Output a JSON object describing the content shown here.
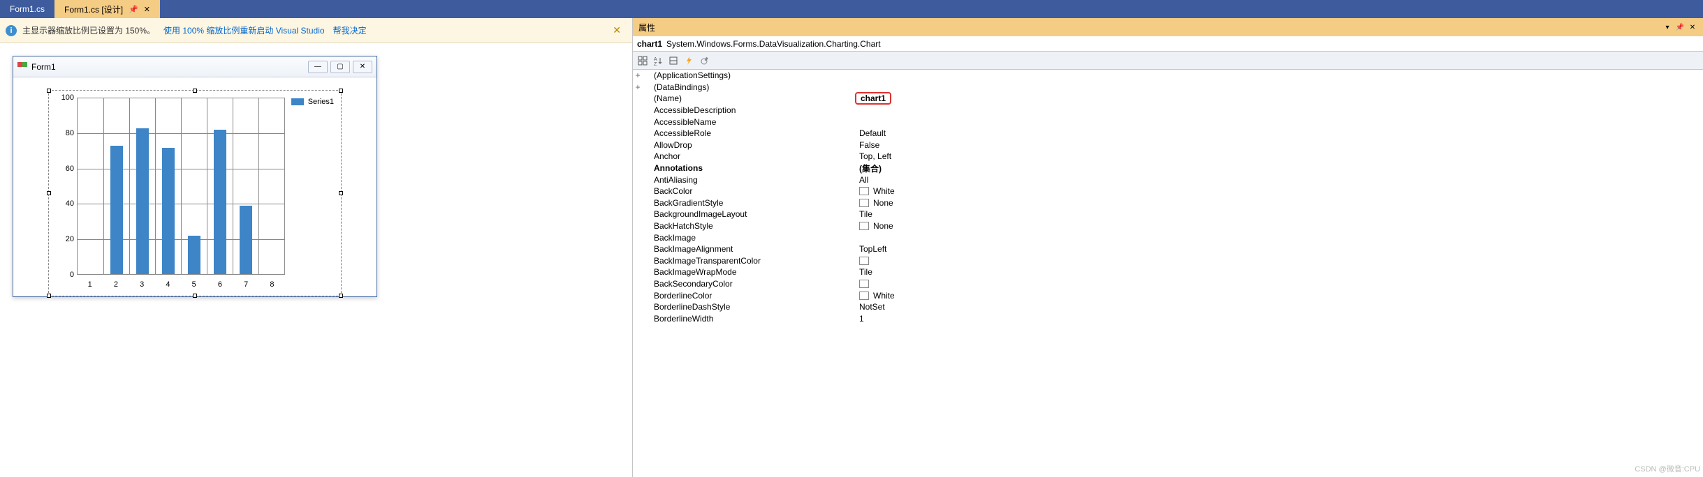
{
  "tabs": {
    "inactive": "Form1.cs",
    "active": "Form1.cs [设计]"
  },
  "infoBar": {
    "msg": "主显示器缩放比例已设置为 150%。",
    "link1": "使用 100% 缩放比例重新启动 Visual Studio",
    "link2": "帮我决定"
  },
  "form": {
    "title": "Form1"
  },
  "legend": "Series1",
  "chart_data": {
    "type": "bar",
    "categories": [
      "1",
      "2",
      "3",
      "4",
      "5",
      "6",
      "7",
      "8"
    ],
    "values": [
      null,
      73,
      83,
      72,
      22,
      82,
      39,
      null
    ],
    "title": "",
    "xlabel": "",
    "ylabel": "",
    "y_ticks": [
      0,
      20,
      40,
      60,
      80,
      100
    ],
    "ylim": [
      0,
      100
    ]
  },
  "propPanel": {
    "title": "属性",
    "objName": "chart1",
    "objType": "System.Windows.Forms.DataVisualization.Charting.Chart",
    "rows": [
      {
        "exp": "+",
        "name": "(ApplicationSettings)",
        "val": ""
      },
      {
        "exp": "+",
        "name": "(DataBindings)",
        "val": ""
      },
      {
        "exp": "",
        "name": "(Name)",
        "val": "chart1",
        "hl": true
      },
      {
        "exp": "",
        "name": "AccessibleDescription",
        "val": ""
      },
      {
        "exp": "",
        "name": "AccessibleName",
        "val": ""
      },
      {
        "exp": "",
        "name": "AccessibleRole",
        "val": "Default"
      },
      {
        "exp": "",
        "name": "AllowDrop",
        "val": "False"
      },
      {
        "exp": "",
        "name": "Anchor",
        "val": "Top, Left"
      },
      {
        "exp": "",
        "name": "Annotations",
        "val": "(集合)",
        "bold": true
      },
      {
        "exp": "",
        "name": "AntiAliasing",
        "val": "All"
      },
      {
        "exp": "",
        "name": "BackColor",
        "val": "White",
        "sw": "#ffffff"
      },
      {
        "exp": "",
        "name": "BackGradientStyle",
        "val": "None",
        "sw": "#ffffff"
      },
      {
        "exp": "",
        "name": "BackgroundImageLayout",
        "val": "Tile"
      },
      {
        "exp": "",
        "name": "BackHatchStyle",
        "val": "None",
        "sw": "#ffffff"
      },
      {
        "exp": "",
        "name": "BackImage",
        "val": ""
      },
      {
        "exp": "",
        "name": "BackImageAlignment",
        "val": "TopLeft"
      },
      {
        "exp": "",
        "name": "BackImageTransparentColor",
        "val": "",
        "sw": "#ffffff"
      },
      {
        "exp": "",
        "name": "BackImageWrapMode",
        "val": "Tile"
      },
      {
        "exp": "",
        "name": "BackSecondaryColor",
        "val": "",
        "sw": "#ffffff"
      },
      {
        "exp": "",
        "name": "BorderlineColor",
        "val": "White",
        "sw": "#ffffff"
      },
      {
        "exp": "",
        "name": "BorderlineDashStyle",
        "val": "NotSet"
      },
      {
        "exp": "",
        "name": "BorderlineWidth",
        "val": "1"
      }
    ]
  },
  "watermark": "CSDN @微音:CPU"
}
